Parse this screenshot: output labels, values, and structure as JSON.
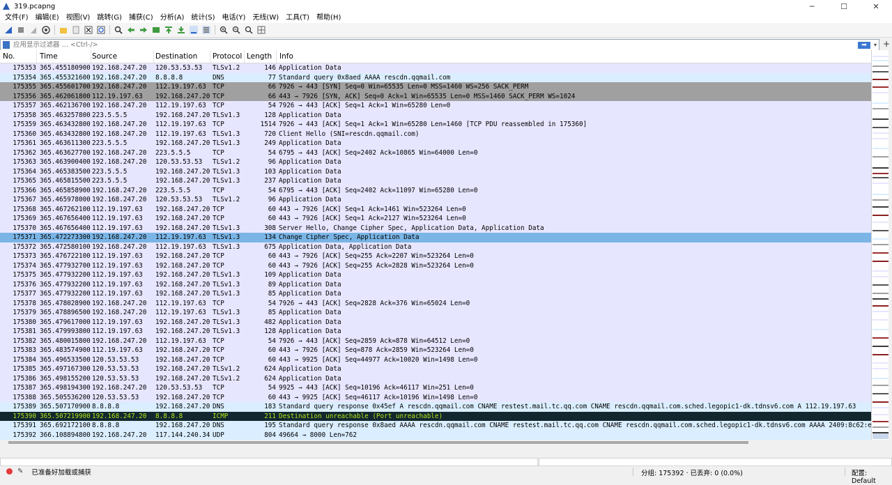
{
  "window": {
    "title": "319.pcapng",
    "minimize": "─",
    "maximize": "☐",
    "close": "✕"
  },
  "menu": [
    "文件(F)",
    "编辑(E)",
    "视图(V)",
    "跳转(G)",
    "捕获(C)",
    "分析(A)",
    "统计(S)",
    "电话(Y)",
    "无线(W)",
    "工具(T)",
    "帮助(H)"
  ],
  "toolbar_icons": [
    "shark-fin-start-icon",
    "stop-icon",
    "restart-icon",
    "options-icon",
    "open-folder-icon",
    "save-icon",
    "close-file-icon",
    "reload-icon",
    "find-icon",
    "go-back-icon",
    "go-forward-icon",
    "go-to-packet-icon",
    "first-packet-icon",
    "last-packet-icon",
    "autoscroll-icon",
    "colorize-icon",
    "zoom-in-icon",
    "zoom-out-icon",
    "zoom-normal-icon",
    "resize-columns-icon"
  ],
  "filter": {
    "placeholder": "应用显示过滤器 … <Ctrl-/>",
    "value": ""
  },
  "columns": {
    "no": "No.",
    "time": "Time",
    "source": "Source",
    "destination": "Destination",
    "protocol": "Protocol",
    "length": "Length",
    "info": "Info"
  },
  "colors": {
    "tcp_rows": "#e7e6ff",
    "dns_rows": "#daeeff",
    "syn_rows": "#a0a0a0",
    "selected": "#7ab5e6",
    "icmp_bg": "#12272e",
    "icmp_fg": "#b5e61d",
    "udp_rows": "#daeeff"
  },
  "packets": [
    {
      "no": "175353",
      "time": "365.455180900",
      "src": "192.168.247.20",
      "dst": "120.53.53.53",
      "proto": "TLSv1.2",
      "len": "146",
      "info": "Application Data",
      "style": "tcp"
    },
    {
      "no": "175354",
      "time": "365.455321600",
      "src": "192.168.247.20",
      "dst": "8.8.8.8",
      "proto": "DNS",
      "len": "77",
      "info": "Standard query 0x8aed AAAA rescdn.qqmail.com",
      "style": "dns"
    },
    {
      "no": "175355",
      "time": "365.455601700",
      "src": "192.168.247.20",
      "dst": "112.19.197.63",
      "proto": "TCP",
      "len": "66",
      "info": "7926 → 443 [SYN] Seq=0 Win=65535 Len=0 MSS=1460 WS=256 SACK_PERM",
      "style": "syn"
    },
    {
      "no": "175356",
      "time": "365.462061800",
      "src": "112.19.197.63",
      "dst": "192.168.247.20",
      "proto": "TCP",
      "len": "66",
      "info": "443 → 7926 [SYN, ACK] Seq=0 Ack=1 Win=65535 Len=0 MSS=1460 SACK_PERM WS=1024",
      "style": "syn"
    },
    {
      "no": "175357",
      "time": "365.462136700",
      "src": "192.168.247.20",
      "dst": "112.19.197.63",
      "proto": "TCP",
      "len": "54",
      "info": "7926 → 443 [ACK] Seq=1 Ack=1 Win=65280 Len=0",
      "style": "tcp"
    },
    {
      "no": "175358",
      "time": "365.463257800",
      "src": "223.5.5.5",
      "dst": "192.168.247.20",
      "proto": "TLSv1.3",
      "len": "128",
      "info": "Application Data",
      "style": "tcp"
    },
    {
      "no": "175359",
      "time": "365.463432800",
      "src": "192.168.247.20",
      "dst": "112.19.197.63",
      "proto": "TCP",
      "len": "1514",
      "info": "7926 → 443 [ACK] Seq=1 Ack=1 Win=65280 Len=1460 [TCP PDU reassembled in 175360]",
      "style": "tcp"
    },
    {
      "no": "175360",
      "time": "365.463432800",
      "src": "192.168.247.20",
      "dst": "112.19.197.63",
      "proto": "TLSv1.3",
      "len": "720",
      "info": "Client Hello (SNI=rescdn.qqmail.com)",
      "style": "tcp"
    },
    {
      "no": "175361",
      "time": "365.463611300",
      "src": "223.5.5.5",
      "dst": "192.168.247.20",
      "proto": "TLSv1.3",
      "len": "249",
      "info": "Application Data",
      "style": "tcp"
    },
    {
      "no": "175362",
      "time": "365.463627700",
      "src": "192.168.247.20",
      "dst": "223.5.5.5",
      "proto": "TCP",
      "len": "54",
      "info": "6795 → 443 [ACK] Seq=2402 Ack=10865 Win=64000 Len=0",
      "style": "tcp"
    },
    {
      "no": "175363",
      "time": "365.463900400",
      "src": "192.168.247.20",
      "dst": "120.53.53.53",
      "proto": "TLSv1.2",
      "len": "96",
      "info": "Application Data",
      "style": "tcp"
    },
    {
      "no": "175364",
      "time": "365.465383500",
      "src": "223.5.5.5",
      "dst": "192.168.247.20",
      "proto": "TLSv1.3",
      "len": "103",
      "info": "Application Data",
      "style": "tcp"
    },
    {
      "no": "175365",
      "time": "365.465815500",
      "src": "223.5.5.5",
      "dst": "192.168.247.20",
      "proto": "TLSv1.3",
      "len": "237",
      "info": "Application Data",
      "style": "tcp"
    },
    {
      "no": "175366",
      "time": "365.465858900",
      "src": "192.168.247.20",
      "dst": "223.5.5.5",
      "proto": "TCP",
      "len": "54",
      "info": "6795 → 443 [ACK] Seq=2402 Ack=11097 Win=65280 Len=0",
      "style": "tcp"
    },
    {
      "no": "175367",
      "time": "365.465978000",
      "src": "192.168.247.20",
      "dst": "120.53.53.53",
      "proto": "TLSv1.2",
      "len": "96",
      "info": "Application Data",
      "style": "tcp"
    },
    {
      "no": "175368",
      "time": "365.467262100",
      "src": "112.19.197.63",
      "dst": "192.168.247.20",
      "proto": "TCP",
      "len": "60",
      "info": "443 → 7926 [ACK] Seq=1 Ack=1461 Win=523264 Len=0",
      "style": "tcp"
    },
    {
      "no": "175369",
      "time": "365.467656400",
      "src": "112.19.197.63",
      "dst": "192.168.247.20",
      "proto": "TCP",
      "len": "60",
      "info": "443 → 7926 [ACK] Seq=1 Ack=2127 Win=523264 Len=0",
      "style": "tcp"
    },
    {
      "no": "175370",
      "time": "365.467656400",
      "src": "112.19.197.63",
      "dst": "192.168.247.20",
      "proto": "TLSv1.3",
      "len": "308",
      "info": "Server Hello, Change Cipher Spec, Application Data, Application Data",
      "style": "tcp"
    },
    {
      "no": "175371",
      "time": "365.472273300",
      "src": "192.168.247.20",
      "dst": "112.19.197.63",
      "proto": "TLSv1.3",
      "len": "134",
      "info": "Change Cipher Spec, Application Data",
      "style": "selected"
    },
    {
      "no": "175372",
      "time": "365.472580100",
      "src": "192.168.247.20",
      "dst": "112.19.197.63",
      "proto": "TLSv1.3",
      "len": "675",
      "info": "Application Data, Application Data",
      "style": "tcp"
    },
    {
      "no": "175373",
      "time": "365.476722100",
      "src": "112.19.197.63",
      "dst": "192.168.247.20",
      "proto": "TCP",
      "len": "60",
      "info": "443 → 7926 [ACK] Seq=255 Ack=2207 Win=523264 Len=0",
      "style": "tcp"
    },
    {
      "no": "175374",
      "time": "365.477932700",
      "src": "112.19.197.63",
      "dst": "192.168.247.20",
      "proto": "TCP",
      "len": "60",
      "info": "443 → 7926 [ACK] Seq=255 Ack=2828 Win=523264 Len=0",
      "style": "tcp"
    },
    {
      "no": "175375",
      "time": "365.477932200",
      "src": "112.19.197.63",
      "dst": "192.168.247.20",
      "proto": "TLSv1.3",
      "len": "109",
      "info": "Application Data",
      "style": "tcp"
    },
    {
      "no": "175376",
      "time": "365.477932200",
      "src": "112.19.197.63",
      "dst": "192.168.247.20",
      "proto": "TLSv1.3",
      "len": "89",
      "info": "Application Data",
      "style": "tcp"
    },
    {
      "no": "175377",
      "time": "365.477932200",
      "src": "112.19.197.63",
      "dst": "192.168.247.20",
      "proto": "TLSv1.3",
      "len": "85",
      "info": "Application Data",
      "style": "tcp"
    },
    {
      "no": "175378",
      "time": "365.478028900",
      "src": "192.168.247.20",
      "dst": "112.19.197.63",
      "proto": "TCP",
      "len": "54",
      "info": "7926 → 443 [ACK] Seq=2828 Ack=376 Win=65024 Len=0",
      "style": "tcp"
    },
    {
      "no": "175379",
      "time": "365.478896500",
      "src": "192.168.247.20",
      "dst": "112.19.197.63",
      "proto": "TLSv1.3",
      "len": "85",
      "info": "Application Data",
      "style": "tcp"
    },
    {
      "no": "175380",
      "time": "365.479617000",
      "src": "112.19.197.63",
      "dst": "192.168.247.20",
      "proto": "TLSv1.3",
      "len": "482",
      "info": "Application Data",
      "style": "tcp"
    },
    {
      "no": "175381",
      "time": "365.479993800",
      "src": "112.19.197.63",
      "dst": "192.168.247.20",
      "proto": "TLSv1.3",
      "len": "128",
      "info": "Application Data",
      "style": "tcp"
    },
    {
      "no": "175382",
      "time": "365.480015800",
      "src": "192.168.247.20",
      "dst": "112.19.197.63",
      "proto": "TCP",
      "len": "54",
      "info": "7926 → 443 [ACK] Seq=2859 Ack=878 Win=64512 Len=0",
      "style": "tcp"
    },
    {
      "no": "175383",
      "time": "365.483574900",
      "src": "112.19.197.63",
      "dst": "192.168.247.20",
      "proto": "TCP",
      "len": "60",
      "info": "443 → 7926 [ACK] Seq=878 Ack=2859 Win=523264 Len=0",
      "style": "tcp"
    },
    {
      "no": "175384",
      "time": "365.496533500",
      "src": "120.53.53.53",
      "dst": "192.168.247.20",
      "proto": "TCP",
      "len": "60",
      "info": "443 → 9925 [ACK] Seq=44977 Ack=10020 Win=1498 Len=0",
      "style": "tcp"
    },
    {
      "no": "175385",
      "time": "365.497167300",
      "src": "120.53.53.53",
      "dst": "192.168.247.20",
      "proto": "TLSv1.2",
      "len": "624",
      "info": "Application Data",
      "style": "tcp"
    },
    {
      "no": "175386",
      "time": "365.498155200",
      "src": "120.53.53.53",
      "dst": "192.168.247.20",
      "proto": "TLSv1.2",
      "len": "624",
      "info": "Application Data",
      "style": "tcp"
    },
    {
      "no": "175387",
      "time": "365.498194300",
      "src": "192.168.247.20",
      "dst": "120.53.53.53",
      "proto": "TCP",
      "len": "54",
      "info": "9925 → 443 [ACK] Seq=10196 Ack=46117 Win=251 Len=0",
      "style": "tcp"
    },
    {
      "no": "175388",
      "time": "365.505536200",
      "src": "120.53.53.53",
      "dst": "192.168.247.20",
      "proto": "TCP",
      "len": "60",
      "info": "443 → 9925 [ACK] Seq=46117 Ack=10196 Win=1498 Len=0",
      "style": "tcp"
    },
    {
      "no": "175389",
      "time": "365.507170900",
      "src": "8.8.8.8",
      "dst": "192.168.247.20",
      "proto": "DNS",
      "len": "183",
      "info": "Standard query response 0x45ef A rescdn.qqmail.com CNAME restest.mail.tc.qq.com CNAME rescdn.qqmail.com.sched.legopic1-dk.tdnsv6.com A 112.19.197.63",
      "style": "dns"
    },
    {
      "no": "175390",
      "time": "365.507219900",
      "src": "192.168.247.20",
      "dst": "8.8.8.8",
      "proto": "ICMP",
      "len": "211",
      "info": "Destination unreachable (Port unreachable)",
      "style": "icmp"
    },
    {
      "no": "175391",
      "time": "365.692172100",
      "src": "8.8.8.8",
      "dst": "192.168.247.20",
      "proto": "DNS",
      "len": "195",
      "info": "Standard query response 0x8aed AAAA rescdn.qqmail.com CNAME restest.mail.tc.qq.com CNAME rescdn.qqmail.com.sched.legopic1-dk.tdnsv6.com AAAA 2409:8c62:e10:89:4",
      "style": "dns"
    },
    {
      "no": "175392",
      "time": "366.108894800",
      "src": "192.168.247.20",
      "dst": "117.144.240.34",
      "proto": "UDP",
      "len": "804",
      "info": "49664 → 8000 Len=762",
      "style": "udp"
    }
  ],
  "status": {
    "ready": "已准备好加载或捕获",
    "stats": "分组: 175392 · 已丢弃: 0 (0.0%)",
    "profile": "配置: Default"
  }
}
